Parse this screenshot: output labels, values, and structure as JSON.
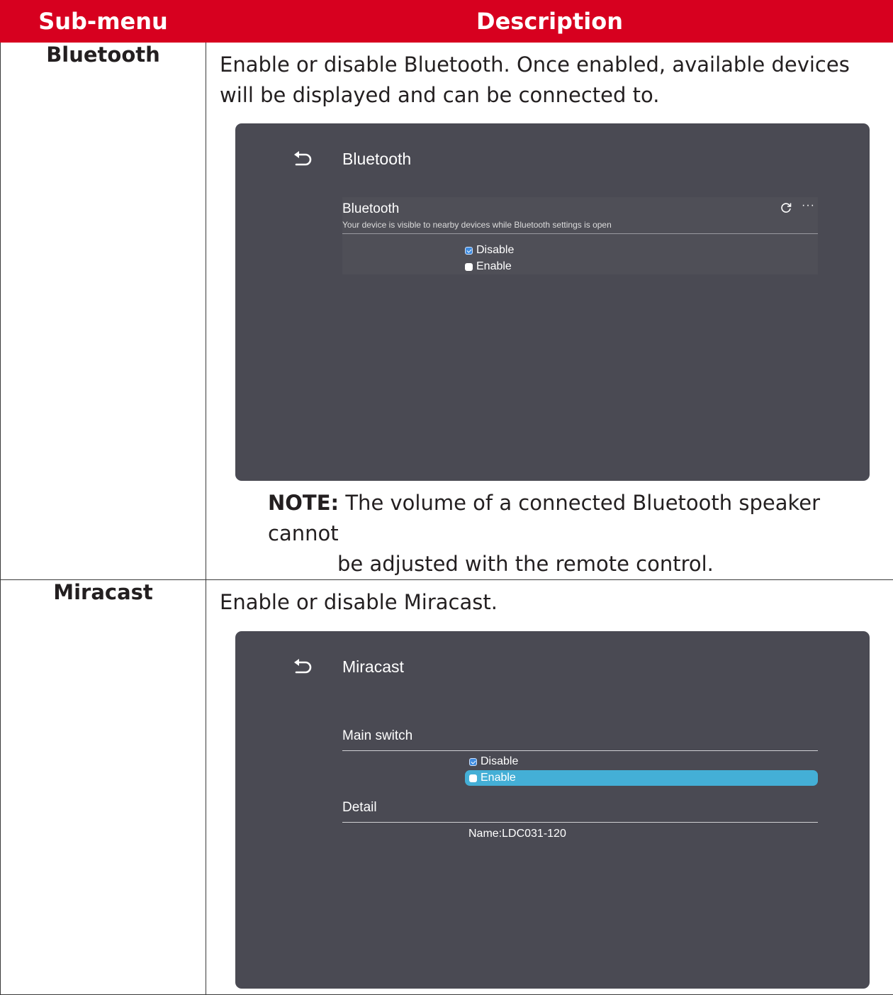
{
  "table": {
    "header": {
      "col1": "Sub-menu",
      "col2": "Description"
    }
  },
  "bluetooth": {
    "submenu": "Bluetooth",
    "description": "Enable or disable Bluetooth. Once enabled, available devices will be displayed and can be connected to.",
    "screen": {
      "title": "Bluetooth",
      "section_title": "Bluetooth",
      "section_subtitle": "Your device is visible to nearby devices while Bluetooth settings is open",
      "more_glyph": "···",
      "options": [
        {
          "label": "Disable",
          "checked": true
        },
        {
          "label": "Enable",
          "checked": false
        }
      ]
    },
    "note_label": "NOTE:",
    "note_line1": "The volume of a connected Bluetooth speaker cannot",
    "note_line2": "be adjusted with the remote control."
  },
  "miracast": {
    "submenu": "Miracast",
    "description": "Enable or disable Miracast.",
    "screen": {
      "title": "Miracast",
      "main_switch_label": "Main switch",
      "options": [
        {
          "label": "Disable",
          "checked": true
        },
        {
          "label": "Enable",
          "checked": false,
          "highlighted": true
        }
      ],
      "detail_label": "Detail",
      "name_value": "Name:LDC031-120"
    }
  },
  "colors": {
    "header_red": "#d7001f",
    "panel_bg": "#4a4a53",
    "highlight_blue": "#44afd6",
    "checkbox_blue": "#3f8ce0"
  }
}
